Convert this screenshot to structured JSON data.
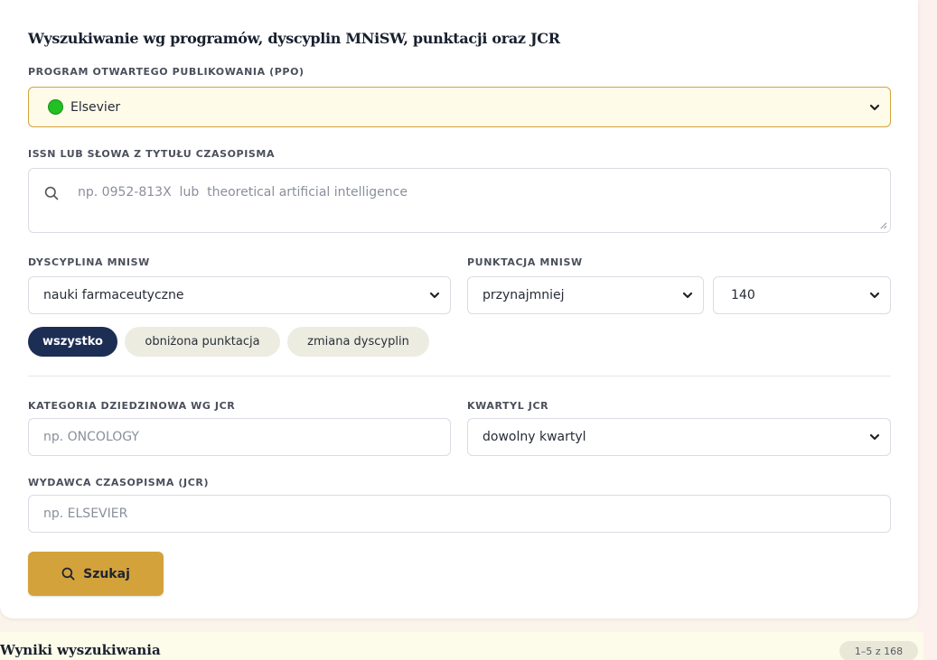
{
  "form": {
    "title": "Wyszukiwanie wg programów, dyscyplin MNiSW, punktacji oraz JCR",
    "ppo": {
      "label": "PROGRAM OTWARTEGO PUBLIKOWANIA (PPO)",
      "value": "Elsevier",
      "status_color": "#22c022"
    },
    "issn": {
      "label": "ISSN LUB SŁOWA Z TYTUŁU CZASOPISMA",
      "placeholder": "np. 0952-813X  lub  theoretical artificial intelligence"
    },
    "discipline": {
      "label": "DYSCYPLINA MNISW",
      "value": "nauki farmaceutyczne"
    },
    "points": {
      "label": "PUNKTACJA MNISW",
      "comparator": "przynajmniej",
      "value": "140"
    },
    "chips": [
      {
        "label": "wszystko",
        "active": true
      },
      {
        "label": "obniżona punktacja",
        "active": false
      },
      {
        "label": "zmiana dyscyplin",
        "active": false
      }
    ],
    "jcr_category": {
      "label": "KATEGORIA DZIEDZINOWA WG JCR",
      "placeholder": "np. ONCOLOGY"
    },
    "jcr_quartile": {
      "label": "KWARTYL JCR",
      "value": "dowolny kwartyl"
    },
    "publisher": {
      "label": "WYDAWCA CZASOPISMA (JCR)",
      "placeholder": "np. ELSEVIER"
    },
    "search_button": {
      "label": "Szukaj",
      "icon": "search-icon"
    }
  },
  "results": {
    "title": "Wyniki wyszukiwania",
    "count": "1–5 z 168"
  },
  "colors": {
    "accent": "#d3a23b",
    "chip_active": "#1d2e55"
  }
}
